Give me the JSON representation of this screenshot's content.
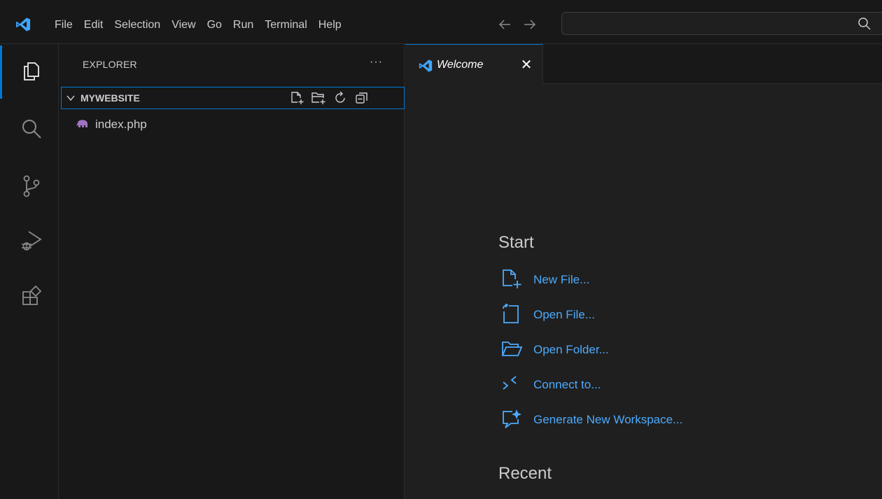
{
  "menu": {
    "items": [
      "File",
      "Edit",
      "Selection",
      "View",
      "Go",
      "Run",
      "Terminal",
      "Help"
    ]
  },
  "icons": {
    "app_logo": "vscode-logo-icon",
    "back": "arrow-left-icon",
    "forward": "arrow-right-icon",
    "search": "search-icon",
    "activity": [
      "explorer-icon",
      "search-icon",
      "source-control-icon",
      "run-debug-icon",
      "extensions-icon"
    ]
  },
  "colors": {
    "accent": "#0078d4",
    "link": "#4daafc",
    "php": "#a074c4"
  },
  "sidebar": {
    "title": "EXPLORER",
    "more": "···",
    "folder": {
      "name": "MYWEBSITE",
      "actions": [
        "new-file-icon",
        "new-folder-icon",
        "refresh-icon",
        "collapse-all-icon"
      ]
    },
    "files": [
      {
        "name": "index.php",
        "icon": "php-elephant-icon"
      }
    ]
  },
  "editor": {
    "tab": {
      "label": "Welcome",
      "close": "✕"
    },
    "welcome": {
      "start_title": "Start",
      "start_items": [
        {
          "label": "New File...",
          "icon": "new-file-icon"
        },
        {
          "label": "Open File...",
          "icon": "open-file-icon"
        },
        {
          "label": "Open Folder...",
          "icon": "open-folder-icon"
        },
        {
          "label": "Connect to...",
          "icon": "remote-icon"
        },
        {
          "label": "Generate New Workspace...",
          "icon": "sparkle-chat-icon"
        }
      ],
      "recent_title": "Recent"
    }
  }
}
